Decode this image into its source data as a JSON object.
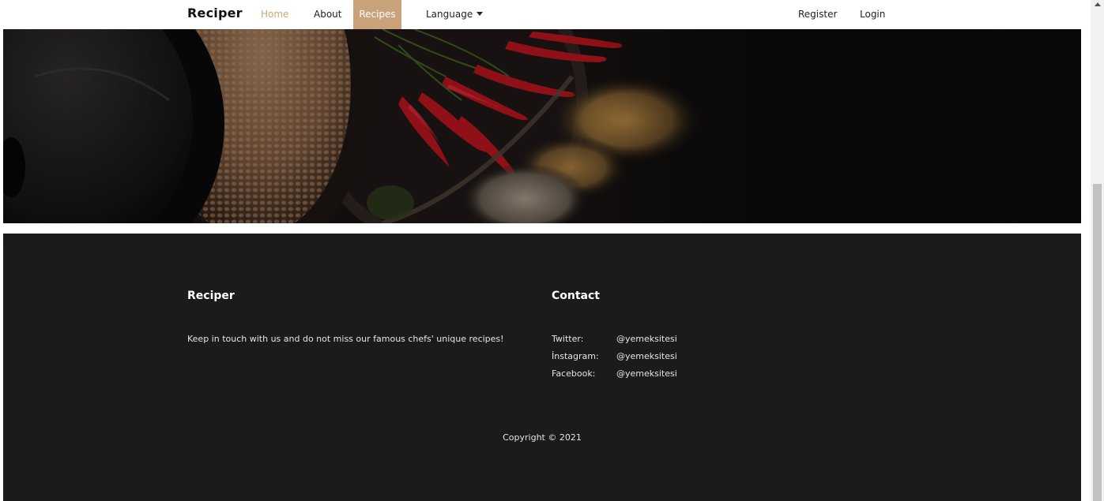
{
  "navbar": {
    "brand": "Reciper",
    "items": {
      "home": "Home",
      "about": "About",
      "recipes": "Recipes",
      "language": "Language",
      "register": "Register",
      "login": "Login"
    },
    "active_item": "Recipes",
    "colors": {
      "active_bg": "#c9a27a",
      "home_text": "#d4a373"
    }
  },
  "hero": {
    "icon": "spices-photo"
  },
  "footer": {
    "brand_title": "Reciper",
    "tagline": "Keep in touch with us and do not miss our famous chefs' unique recipes!",
    "contact_title": "Contact",
    "contacts": [
      {
        "label": "Twitter:",
        "handle": "@yemeksitesi"
      },
      {
        "label": "İnstagram:",
        "handle": "@yemeksitesi"
      },
      {
        "label": "Facebook:",
        "handle": "@yemeksitesi"
      }
    ],
    "copyright": "Copyright © 2021",
    "colors": {
      "background": "#1c1a1a",
      "text": "#e5e5e5"
    }
  }
}
